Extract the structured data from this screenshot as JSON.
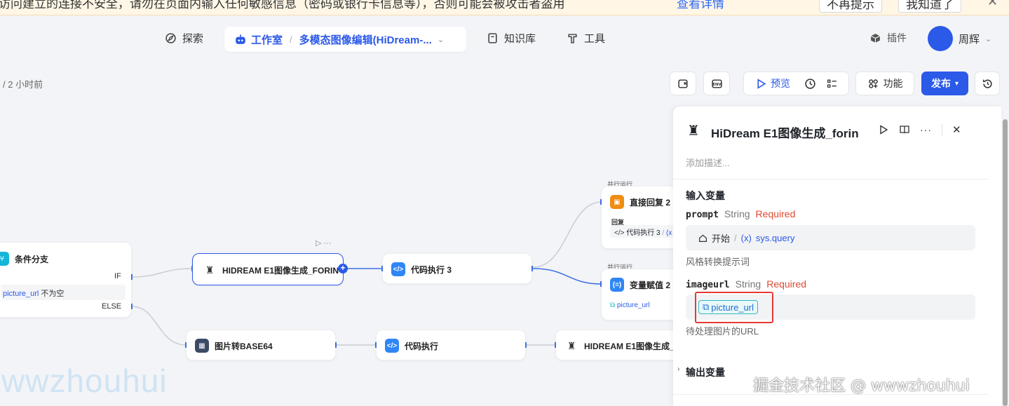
{
  "warning": {
    "text": "访问建立的连接不安全，请勿在页面内输入任何敏感信息（密码或银行卡信息等），否则可能会被攻击者盗用",
    "link": "查看详情",
    "btn_no_remind": "不再提示",
    "btn_ok": "我知道了",
    "close": "✕"
  },
  "nav": {
    "explore": "探索",
    "studio": "工作室",
    "project_title": "多模态图像编辑(HiDream-...",
    "knowledge": "知识库",
    "tools": "工具",
    "plugins": "插件",
    "user": "周辉"
  },
  "toolbar": {
    "timestamp": "/ 2 小时前",
    "preview": "预览",
    "features": "功能",
    "publish": "发布"
  },
  "canvas": {
    "cond_node": {
      "title": "条件分支",
      "if": "IF",
      "condition_var": "picture_url",
      "condition_op": "不为空",
      "else": "ELSE"
    },
    "hidream_node": {
      "title": "HIDREAM E1图像生成_FORIN"
    },
    "code3_node": {
      "title": "代码执行 3"
    },
    "parallel_label_1": "并行运行",
    "reply_node": {
      "title": "直接回复 2",
      "sub": "回复",
      "ref": "代码执行 3",
      "ref2": "(x"
    },
    "parallel_label_2": "并行运行",
    "assign_node": {
      "title": "变量赋值 2",
      "ref": "picture_url"
    },
    "b64_node": {
      "title": "图片转BASE64"
    },
    "code_node": {
      "title": "代码执行"
    },
    "hidream2_node": {
      "title": "HIDREAM E1图像生成_F"
    }
  },
  "panel": {
    "title": "HiDream E1图像生成_forin",
    "description_placeholder": "添加描述...",
    "input_section": "输入变量",
    "var1": {
      "name": "prompt",
      "type": "String",
      "required": "Required",
      "source": "开始",
      "ref": "sys.query",
      "hint": "风格转换提示词"
    },
    "var2": {
      "name": "imageurl",
      "type": "String",
      "required": "Required",
      "ref": "picture_url",
      "hint": "待处理图片的URL"
    },
    "output_section": "输出变量"
  },
  "watermark": {
    "left": "wwzhouhui",
    "right": "掘金技术社区 @ wwwzhouhui"
  },
  "colors": {
    "accent": "#2b59e8",
    "required": "#e0482f",
    "highlight": "#e53936"
  }
}
